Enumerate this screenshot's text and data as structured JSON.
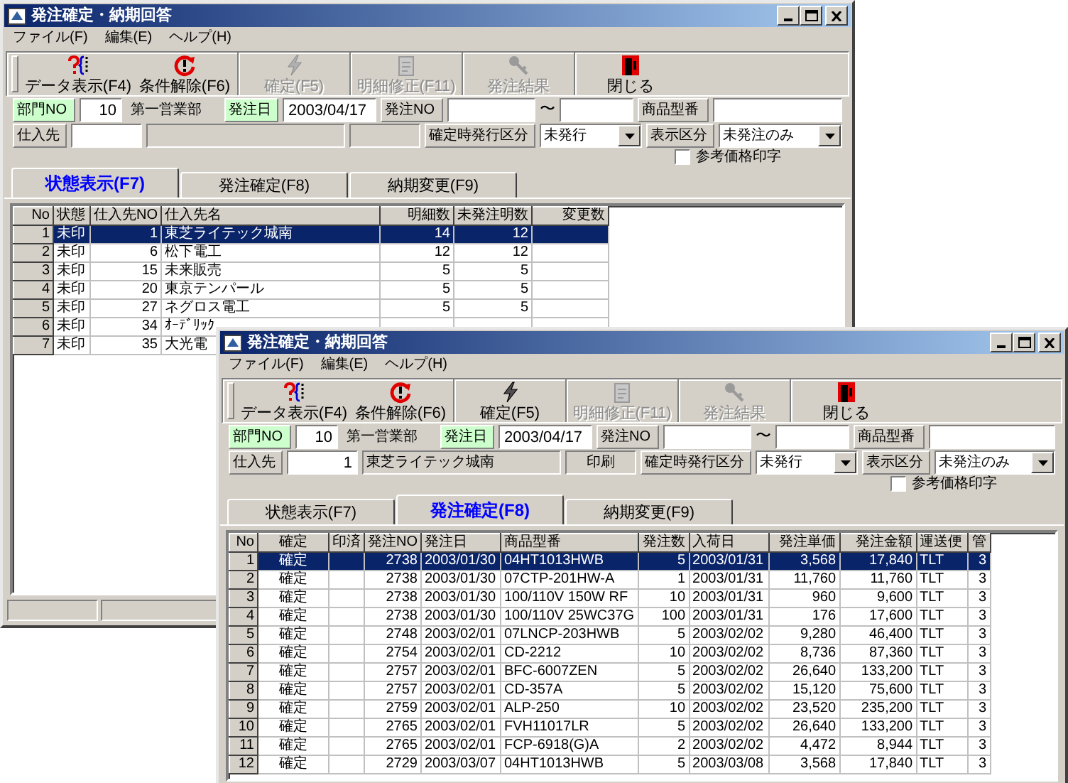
{
  "windows": [
    {
      "title": "発注確定・納期回答",
      "menu": [
        "ファイル(F)",
        "編集(E)",
        "ヘルプ(H)"
      ],
      "toolbar": [
        {
          "kind": "data",
          "label": "データ表示(F4)",
          "disabled": false
        },
        {
          "kind": "reset",
          "label": "条件解除(F6)",
          "disabled": false
        },
        {
          "kind": "confirm",
          "label": "確定(F5)",
          "disabled": true
        },
        {
          "kind": "edit",
          "label": "明細修正(F11)",
          "disabled": true
        },
        {
          "kind": "result",
          "label": "発注結果",
          "disabled": true
        },
        {
          "kind": "close",
          "label": "閉じる",
          "disabled": false
        }
      ],
      "filter": {
        "department_label": "部門NO",
        "department_no": "10",
        "department_name": "第一営業部",
        "order_date_label": "発注日",
        "order_date": "2003/04/17",
        "order_no_label": "発注NO",
        "range_separator": "〜",
        "product_code_label": "商品型番",
        "supplier_label": "仕入先",
        "issue_type_label": "確定時発行区分",
        "issue_type": "未発行",
        "display_type_label": "表示区分",
        "display_type": "未発注のみ",
        "reference_price": {
          "label": "参考価格印字",
          "checked": false
        }
      },
      "tabs": [
        {
          "label": "状態表示(F7)",
          "selected": true
        },
        {
          "label": "発注確定(F8)",
          "selected": false
        },
        {
          "label": "納期変更(F9)",
          "selected": false
        }
      ],
      "table": {
        "columns": [
          "No",
          "状態",
          "仕入先NO",
          "仕入先名",
          "明細数",
          "未発注明数",
          "変更数"
        ],
        "rows": [
          {
            "selected": true,
            "no": "1",
            "status": "未印",
            "supplier_no": "1",
            "supplier_name": "東芝ライテック城南",
            "detail_count": "14",
            "unordered_count": "12"
          },
          {
            "selected": false,
            "no": "2",
            "status": "未印",
            "supplier_no": "6",
            "supplier_name": "松下電工",
            "detail_count": "12",
            "unordered_count": "12"
          },
          {
            "selected": false,
            "no": "3",
            "status": "未印",
            "supplier_no": "15",
            "supplier_name": "未来販売",
            "detail_count": "5",
            "unordered_count": "5"
          },
          {
            "selected": false,
            "no": "4",
            "status": "未印",
            "supplier_no": "20",
            "supplier_name": "東京テンパール",
            "detail_count": "5",
            "unordered_count": "5"
          },
          {
            "selected": false,
            "no": "5",
            "status": "未印",
            "supplier_no": "27",
            "supplier_name": "ネグロス電工",
            "detail_count": "5",
            "unordered_count": "5"
          },
          {
            "selected": false,
            "no": "6",
            "status": "未印",
            "supplier_no": "34",
            "supplier_name": "ｵｰﾃﾞﾘｯｸ"
          },
          {
            "selected": false,
            "no": "7",
            "status": "未印",
            "supplier_no": "35",
            "supplier_name": "大光電"
          }
        ]
      }
    },
    {
      "title": "発注確定・納期回答",
      "menu": [
        "ファイル(F)",
        "編集(E)",
        "ヘルプ(H)"
      ],
      "toolbar": [
        {
          "kind": "data",
          "label": "データ表示(F4)",
          "disabled": false
        },
        {
          "kind": "reset",
          "label": "条件解除(F6)",
          "disabled": false
        },
        {
          "kind": "confirm",
          "label": "確定(F5)",
          "disabled": false
        },
        {
          "kind": "edit",
          "label": "明細修正(F11)",
          "disabled": true
        },
        {
          "kind": "result",
          "label": "発注結果",
          "disabled": true
        },
        {
          "kind": "close",
          "label": "閉じる",
          "disabled": false
        }
      ],
      "filter": {
        "department_label": "部門NO",
        "department_no": "10",
        "department_name": "第一営業部",
        "order_date_label": "発注日",
        "order_date": "2003/04/17",
        "order_no_label": "発注NO",
        "range_separator": "〜",
        "product_code_label": "商品型番",
        "supplier_label": "仕入先",
        "supplier_no": "1",
        "supplier_name": "東芝ライテック城南",
        "print_label": "印刷",
        "issue_type_label": "確定時発行区分",
        "issue_type": "未発行",
        "display_type_label": "表示区分",
        "display_type": "未発注のみ",
        "reference_price": {
          "label": "参考価格印字",
          "checked": false
        }
      },
      "tabs": [
        {
          "label": "状態表示(F7)",
          "selected": false
        },
        {
          "label": "発注確定(F8)",
          "selected": true
        },
        {
          "label": "納期変更(F9)",
          "selected": false
        }
      ],
      "table": {
        "columns": [
          "No",
          "確定",
          "印済",
          "発注NO",
          "発注日",
          "商品型番",
          "発注数",
          "入荷日",
          "発注単価",
          "発注金額",
          "運送便",
          "管"
        ],
        "rows": [
          {
            "selected": true,
            "no": "1",
            "confirm": "確定",
            "order_no": "2738",
            "order_date": "2003/01/30",
            "product_code": "04HT1013HWB",
            "quantity": "5",
            "arrival_date": "2003/01/31",
            "unit_price": "3,568",
            "amount": "17,840",
            "carrier": "TLT",
            "column_12": "3"
          },
          {
            "selected": false,
            "no": "2",
            "confirm": "確定",
            "order_no": "2738",
            "order_date": "2003/01/30",
            "product_code": "07CTP-201HW-A",
            "quantity": "1",
            "arrival_date": "2003/01/31",
            "unit_price": "11,760",
            "amount": "11,760",
            "carrier": "TLT",
            "column_12": "3"
          },
          {
            "selected": false,
            "no": "3",
            "confirm": "確定",
            "order_no": "2738",
            "order_date": "2003/01/30",
            "product_code": "100/110V 150W RF",
            "quantity": "10",
            "arrival_date": "2003/01/31",
            "unit_price": "960",
            "amount": "9,600",
            "carrier": "TLT",
            "column_12": "3"
          },
          {
            "selected": false,
            "no": "4",
            "confirm": "確定",
            "order_no": "2738",
            "order_date": "2003/01/30",
            "product_code": "100/110V 25WC37G",
            "quantity": "100",
            "arrival_date": "2003/01/31",
            "unit_price": "176",
            "amount": "17,600",
            "carrier": "TLT",
            "column_12": "3"
          },
          {
            "selected": false,
            "no": "5",
            "confirm": "確定",
            "order_no": "2748",
            "order_date": "2003/02/01",
            "product_code": "07LNCP-203HWB",
            "quantity": "5",
            "arrival_date": "2003/02/02",
            "unit_price": "9,280",
            "amount": "46,400",
            "carrier": "TLT",
            "column_12": "3"
          },
          {
            "selected": false,
            "no": "6",
            "confirm": "確定",
            "order_no": "2754",
            "order_date": "2003/02/01",
            "product_code": "CD-2212",
            "quantity": "10",
            "arrival_date": "2003/02/02",
            "unit_price": "8,736",
            "amount": "87,360",
            "carrier": "TLT",
            "column_12": "3"
          },
          {
            "selected": false,
            "no": "7",
            "confirm": "確定",
            "order_no": "2757",
            "order_date": "2003/02/01",
            "product_code": "BFC-6007ZEN",
            "quantity": "5",
            "arrival_date": "2003/02/02",
            "unit_price": "26,640",
            "amount": "133,200",
            "carrier": "TLT",
            "column_12": "3"
          },
          {
            "selected": false,
            "no": "8",
            "confirm": "確定",
            "order_no": "2757",
            "order_date": "2003/02/01",
            "product_code": "CD-357A",
            "quantity": "5",
            "arrival_date": "2003/02/02",
            "unit_price": "15,120",
            "amount": "75,600",
            "carrier": "TLT",
            "column_12": "3"
          },
          {
            "selected": false,
            "no": "9",
            "confirm": "確定",
            "order_no": "2759",
            "order_date": "2003/02/01",
            "product_code": "ALP-250",
            "quantity": "10",
            "arrival_date": "2003/02/02",
            "unit_price": "23,520",
            "amount": "235,200",
            "carrier": "TLT",
            "column_12": "3"
          },
          {
            "selected": false,
            "no": "10",
            "confirm": "確定",
            "order_no": "2765",
            "order_date": "2003/02/01",
            "product_code": "FVH11017LR",
            "quantity": "5",
            "arrival_date": "2003/02/02",
            "unit_price": "26,640",
            "amount": "133,200",
            "carrier": "TLT",
            "column_12": "3"
          },
          {
            "selected": false,
            "no": "11",
            "confirm": "確定",
            "order_no": "2765",
            "order_date": "2003/02/01",
            "product_code": "FCP-6918(G)A",
            "quantity": "2",
            "arrival_date": "2003/02/02",
            "unit_price": "4,472",
            "amount": "8,944",
            "carrier": "TLT",
            "column_12": "3"
          },
          {
            "selected": false,
            "no": "12",
            "confirm": "確定",
            "order_no": "2729",
            "order_date": "2003/03/07",
            "product_code": "04HT1013HWB",
            "quantity": "5",
            "arrival_date": "2003/03/08",
            "unit_price": "3,568",
            "amount": "17,840",
            "carrier": "TLT",
            "column_12": "3"
          }
        ]
      }
    }
  ]
}
